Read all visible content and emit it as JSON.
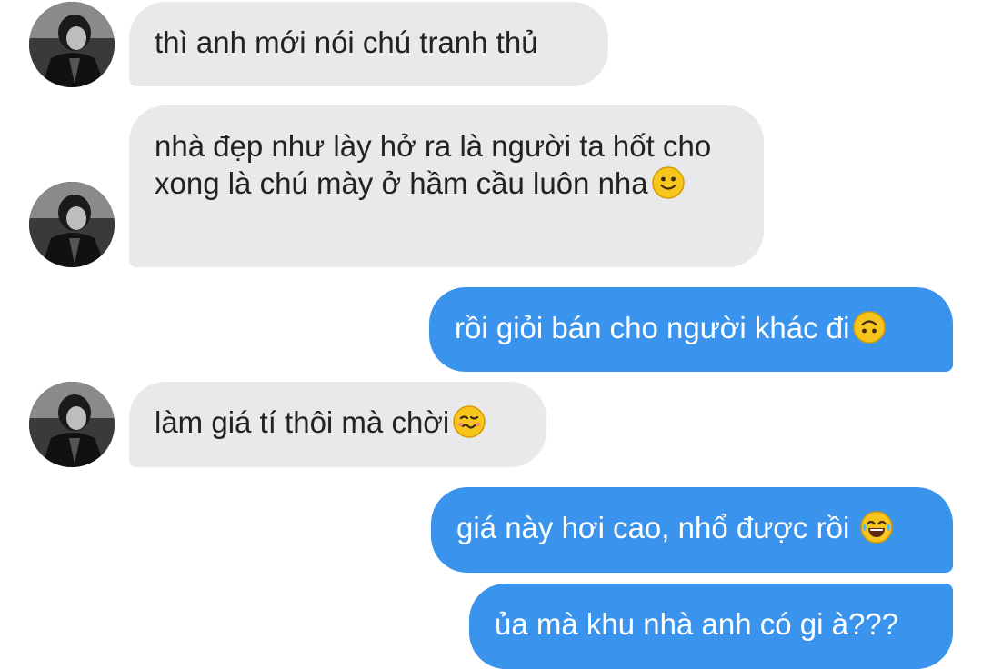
{
  "colors": {
    "incoming_bubble": "#e9e9eb",
    "outgoing_bubble": "#3a94ee",
    "incoming_text": "#222222",
    "outgoing_text": "#ffffff"
  },
  "messages": [
    {
      "side": "incoming",
      "text": "thì anh mới nói chú tranh thủ",
      "emoji": ""
    },
    {
      "side": "incoming",
      "text": "nhà đẹp như lày hở ra là người ta hốt cho xong là chú mày ở hầm cầu luôn nha",
      "emoji": "slightly-smiling-face-icon"
    },
    {
      "side": "outgoing",
      "text": "rồi giỏi bán cho người khác đi",
      "emoji": "upside-down-face-icon"
    },
    {
      "side": "incoming",
      "text": "làm giá tí thôi mà chời",
      "emoji": "woozy-face-icon"
    },
    {
      "side": "outgoing",
      "text": "giá này hơi cao, nhổ được rồi",
      "emoji": "tears-of-joy-face-icon"
    },
    {
      "side": "outgoing",
      "text": "ủa mà khu nhà anh có gi à???",
      "emoji": ""
    }
  ]
}
